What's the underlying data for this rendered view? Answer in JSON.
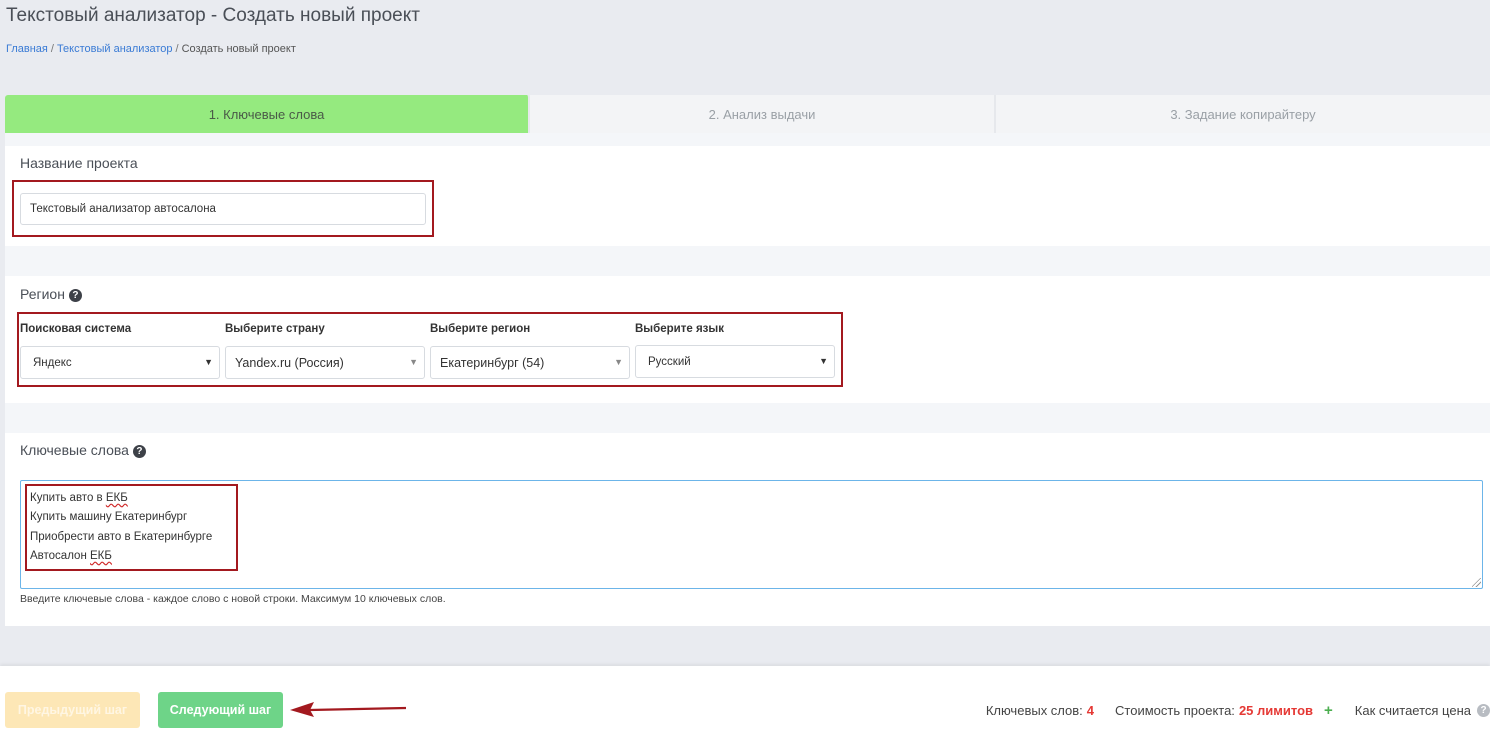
{
  "page": {
    "title": "Текстовый анализатор - Создать новый проект",
    "breadcrumb": [
      "Главная",
      "Текстовый анализатор",
      "Создать новый проект"
    ]
  },
  "wizard": {
    "steps": [
      {
        "label": "1. Ключевые слова",
        "active": true
      },
      {
        "label": "2. Анализ выдачи",
        "active": false
      },
      {
        "label": "3. Задание копирайтеру",
        "active": false
      }
    ]
  },
  "project": {
    "name_label": "Название проекта",
    "name_value": "Текстовый анализатор автосалона"
  },
  "region": {
    "label": "Регион",
    "selects": [
      {
        "label": "Поисковая система",
        "value": "Яндекс"
      },
      {
        "label": "Выберите страну",
        "value": "Yandex.ru (Россия)"
      },
      {
        "label": "Выберите регион",
        "value": "Екатеринбург (54)"
      },
      {
        "label": "Выберите язык",
        "value": "Русский"
      }
    ]
  },
  "keywords": {
    "label": "Ключевые слова",
    "lines": [
      "Купить авто в ЕКБ",
      "Купить машину Екатеринбург",
      "Приобрести авто в Екатеринбурге",
      "Автосалон ЕКБ"
    ],
    "hint": "Введите ключевые слова - каждое слово с новой строки. Максимум 10 ключевых слов."
  },
  "footer": {
    "prev_label": "Предыдущий шаг",
    "next_label": "Следующий шаг",
    "keyword_count_label": "Ключевых слов:",
    "keyword_count": "4",
    "cost_label": "Стоимость проекта:",
    "cost_value": "25 лимитов",
    "plus": "+",
    "price_link": "Как считается цена"
  },
  "colors": {
    "active_step": "#95ea7f",
    "next_button": "#6ed488",
    "prev_button": "#fde7b6",
    "highlight_box": "#a3191f",
    "accent_number": "#e53935"
  }
}
